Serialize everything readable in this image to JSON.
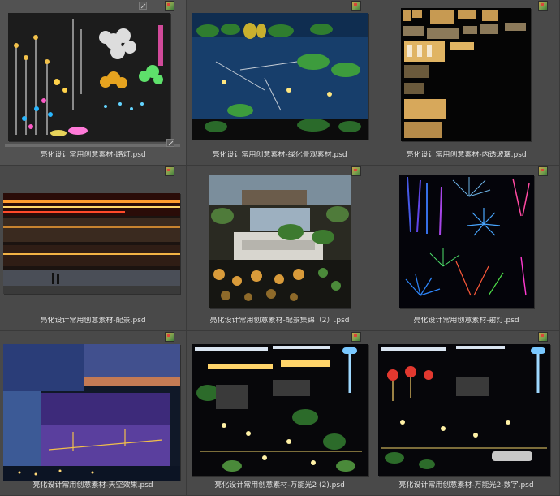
{
  "tiles": [
    {
      "caption": "亮化设计常用创意素材-路灯.psd",
      "selected": true
    },
    {
      "caption": "亮化设计常用创意素材-绿化景观素材.psd"
    },
    {
      "caption": "亮化设计常用创意素材-内透玻璃.psd"
    },
    {
      "caption": "亮化设计常用创意素材-配景.psd"
    },
    {
      "caption": "亮化设计常用创意素材-配景集锦（2）.psd"
    },
    {
      "caption": "亮化设计常用创意素材-射灯.psd"
    },
    {
      "caption": "亮化设计常用创意素材-天空效果.psd"
    },
    {
      "caption": "亮化设计常用创意素材-万能光2 (2).psd"
    },
    {
      "caption": "亮化设计常用创意素材-万能光2-数字.psd"
    }
  ],
  "icons": {
    "file_badge": "photoshop-file-icon",
    "resize": "resize-handle-icon"
  },
  "colors": {
    "background": "#444444",
    "caption": "#e2e2e2"
  }
}
